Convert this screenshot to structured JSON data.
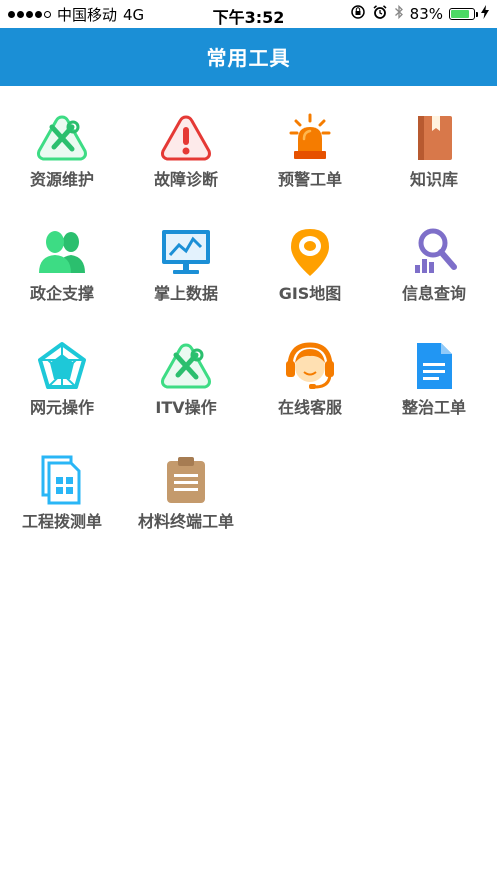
{
  "status_bar": {
    "carrier": "中国移动",
    "network": "4G",
    "time": "下午3:52",
    "battery": "83%",
    "battery_level": 0.83
  },
  "nav": {
    "title": "常用工具"
  },
  "tools": [
    {
      "label": "资源维护",
      "icon": "wrench-screwdriver-icon"
    },
    {
      "label": "故障诊断",
      "icon": "warning-icon"
    },
    {
      "label": "预警工单",
      "icon": "alarm-light-icon"
    },
    {
      "label": "知识库",
      "icon": "book-icon"
    },
    {
      "label": "政企支撑",
      "icon": "users-icon"
    },
    {
      "label": "掌上数据",
      "icon": "monitor-chart-icon"
    },
    {
      "label": "GIS地图",
      "icon": "map-pin-icon"
    },
    {
      "label": "信息查询",
      "icon": "search-chart-icon"
    },
    {
      "label": "网元操作",
      "icon": "network-icon"
    },
    {
      "label": "ITV操作",
      "icon": "wrench-screwdriver-icon"
    },
    {
      "label": "在线客服",
      "icon": "headset-icon"
    },
    {
      "label": "整治工单",
      "icon": "document-icon"
    },
    {
      "label": "工程拨测单",
      "icon": "document-grid-icon"
    },
    {
      "label": "材料终端工单",
      "icon": "clipboard-icon"
    }
  ],
  "colors": {
    "nav": "#1b8fd6",
    "green": "#3ddc84",
    "red": "#e53935",
    "orange": "#f57c00",
    "blue": "#2196f3",
    "brown": "#c49a6c",
    "purple": "#7e6fc9",
    "cyan": "#1ec8d8"
  }
}
